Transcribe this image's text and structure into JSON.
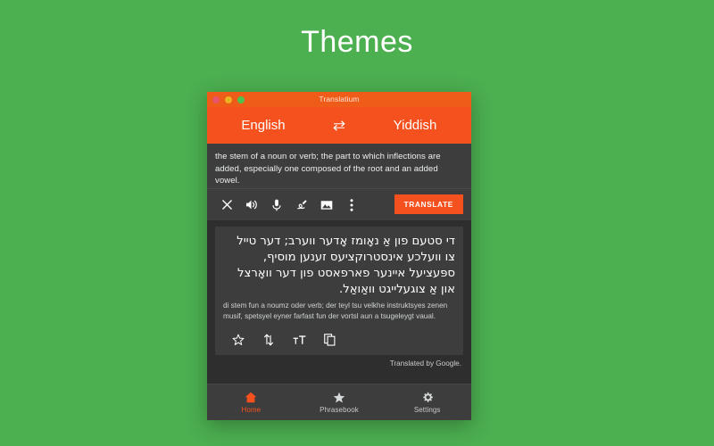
{
  "page": {
    "background_color": "#4CAF50",
    "hero_title": "Themes"
  },
  "window": {
    "title": "Translatium",
    "titlebar_color": "#ef5b18",
    "traffic_lights": [
      {
        "name": "close",
        "color": "#e8556b"
      },
      {
        "name": "minimize",
        "color": "#e9b020"
      },
      {
        "name": "maximize",
        "color": "#4fc14f"
      }
    ]
  },
  "language_bar": {
    "accent_color": "#f4511e",
    "source_language": "English",
    "swap_icon": "swap-horizontal-icon",
    "target_language": "Yiddish"
  },
  "input": {
    "text": "the stem of a noun or verb; the part to which inflections are added, especially one composed of the root and an added vowel.",
    "toolbar": [
      {
        "icon": "close-icon",
        "label": "Clear"
      },
      {
        "icon": "speaker-icon",
        "label": "Listen"
      },
      {
        "icon": "microphone-icon",
        "label": "Speak"
      },
      {
        "icon": "handwriting-icon",
        "label": "Handwriting"
      },
      {
        "icon": "image-icon",
        "label": "Image"
      },
      {
        "icon": "more-vertical-icon",
        "label": "More"
      }
    ],
    "translate_label": "TRANSLATE",
    "translate_color": "#f4511e"
  },
  "output": {
    "translated_text": "די סטעם פון אַ נאָומז אָדער ווערב; דער טייל צו וועלכע אינסטרוקציעס זענען מוסיף, ספּעציעל איינער פארפאסט פון דער וואָרצל און אַ צוגעלייגט וואַואַל.",
    "transliteration": "di stem fun a noumz oder verb; der teyl tsu velkhe instruktsyes zenen musif, spetsyel eyner farfast fun der vortsl aun a tsugeleygt vaual.",
    "toolbar": [
      {
        "icon": "star-icon",
        "label": "Favorite"
      },
      {
        "icon": "swap-vertical-icon",
        "label": "Swap"
      },
      {
        "icon": "text-size-icon",
        "label": "Text size"
      },
      {
        "icon": "copy-icon",
        "label": "Copy"
      }
    ],
    "attribution": "Translated by Google."
  },
  "bottom_nav": {
    "active_color": "#f4511e",
    "items": [
      {
        "icon": "home-icon",
        "label": "Home",
        "active": true
      },
      {
        "icon": "star-icon",
        "label": "Phrasebook",
        "active": false
      },
      {
        "icon": "gear-icon",
        "label": "Settings",
        "active": false
      }
    ]
  }
}
